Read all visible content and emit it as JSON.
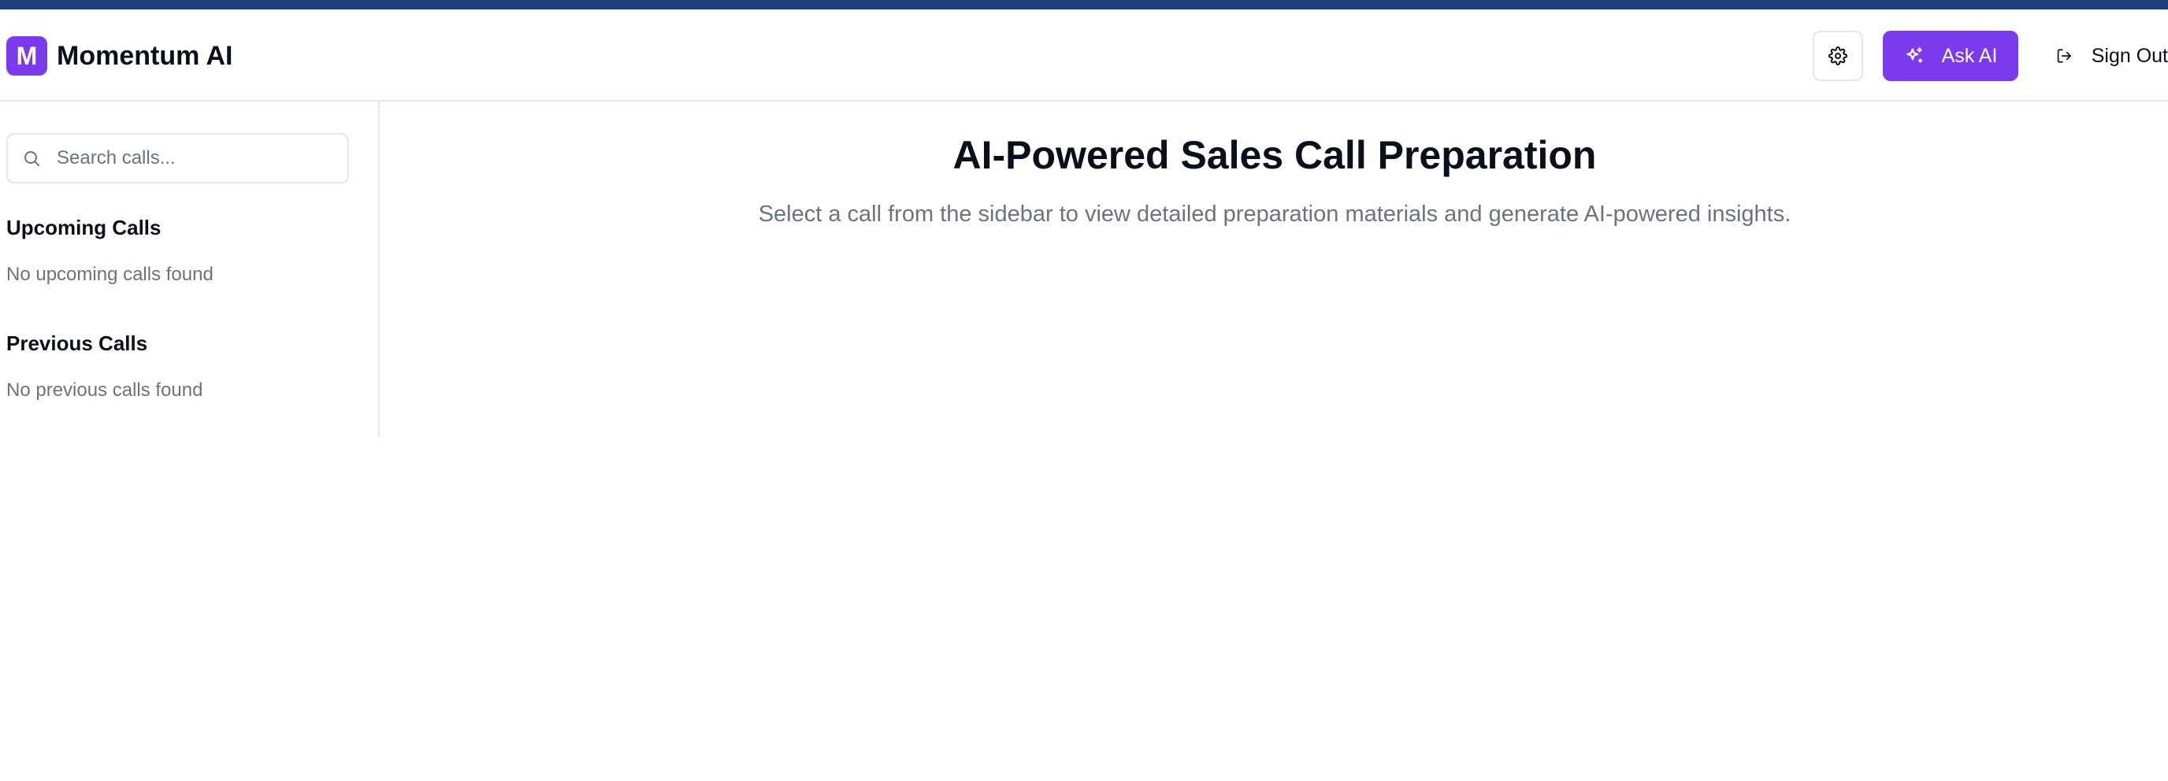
{
  "app": {
    "logo_letter": "M",
    "title": "Momentum AI"
  },
  "header": {
    "settings_icon": "gear-icon",
    "ask_ai_label": "Ask AI",
    "ask_ai_icon": "sparkles-icon",
    "sign_out_label": "Sign Out",
    "sign_out_icon": "log-out-icon"
  },
  "sidebar": {
    "search": {
      "placeholder": "Search calls...",
      "value": ""
    },
    "upcoming": {
      "title": "Upcoming Calls",
      "empty": "No upcoming calls found"
    },
    "previous": {
      "title": "Previous Calls",
      "empty": "No previous calls found"
    }
  },
  "main": {
    "title": "AI-Powered Sales Call Preparation",
    "subtitle": "Select a call from the sidebar to view detailed preparation materials and generate AI-powered insights."
  },
  "colors": {
    "accent": "#7c3aed",
    "top_strip": "#1e3f7a",
    "muted_text": "#6b7280",
    "border": "#e5e7eb"
  }
}
